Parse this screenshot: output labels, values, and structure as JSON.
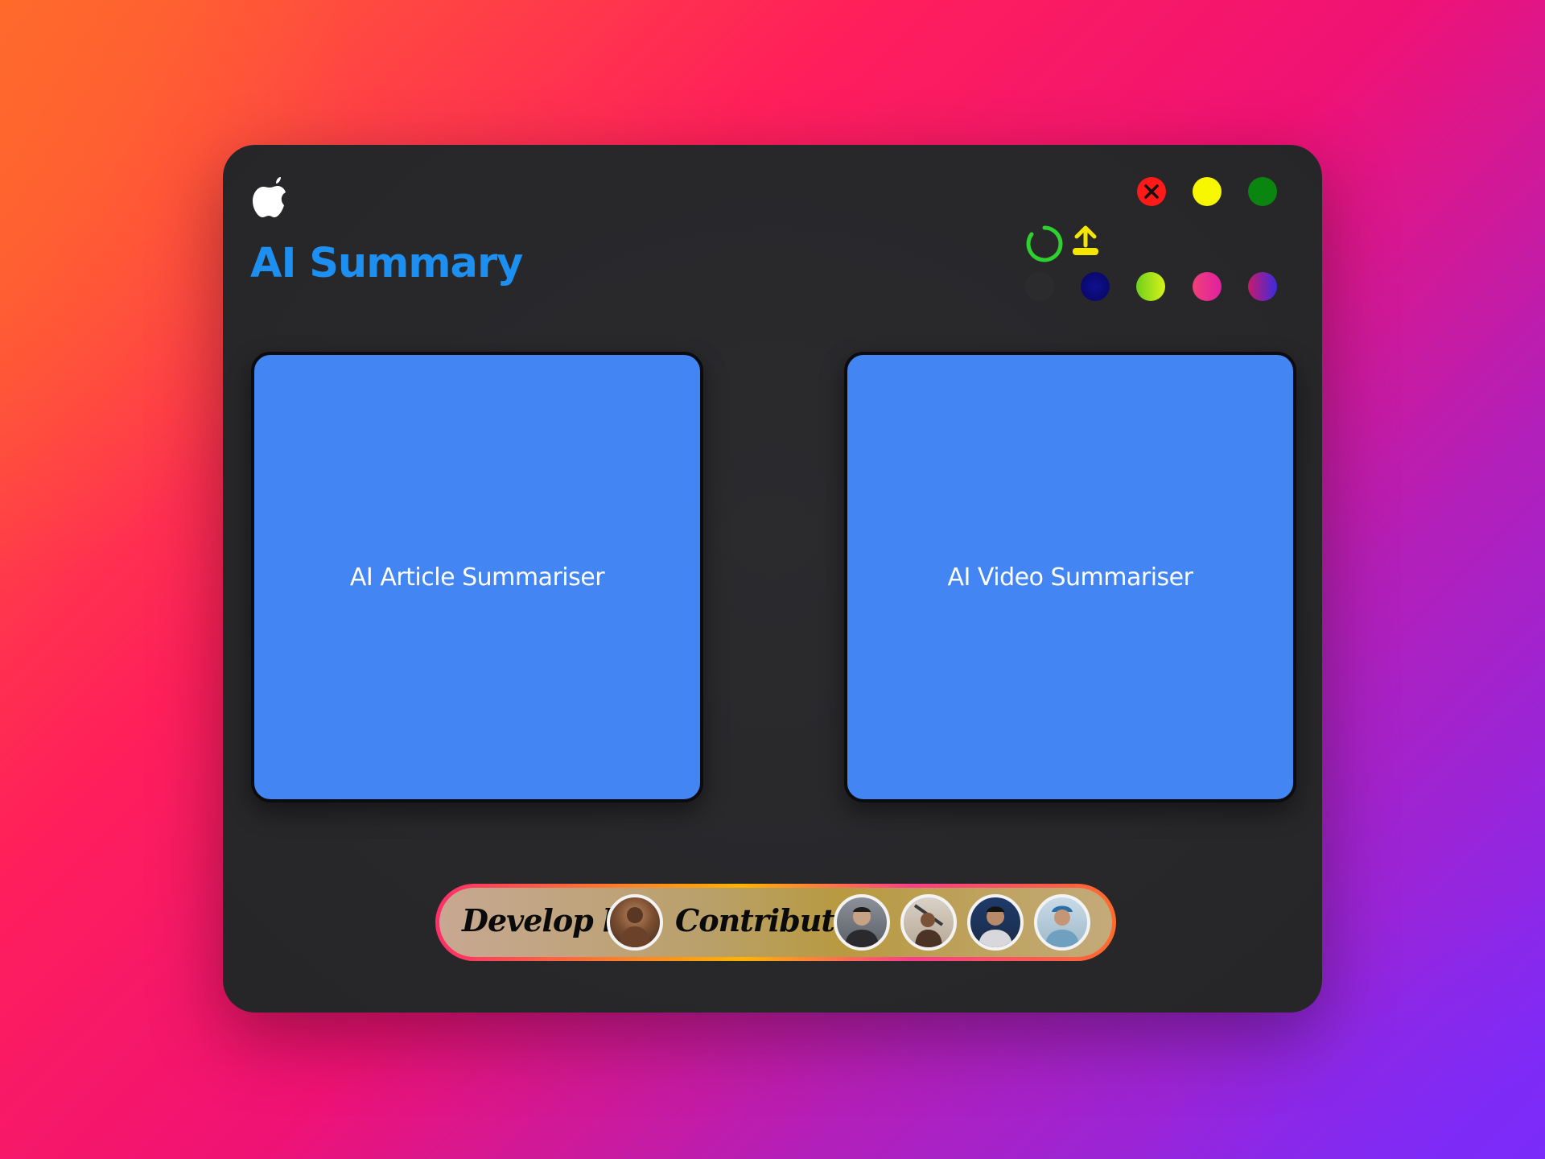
{
  "window": {
    "title": "AI Summary",
    "logo_icon": "apple-logo-icon"
  },
  "traffic_lights": [
    {
      "name": "close",
      "color": "#ff1a1a",
      "icon": "close-icon"
    },
    {
      "name": "minimize",
      "color": "#f7f700"
    },
    {
      "name": "maximize",
      "color": "#0a850f"
    }
  ],
  "toolbar": {
    "icons": [
      "refresh-icon",
      "upload-icon"
    ],
    "refresh_color": "#2fd12f",
    "upload_color": "#f5e600"
  },
  "theme_swatches": [
    {
      "name": "dark",
      "color": "#2b2b2d"
    },
    {
      "name": "navy",
      "color": "#0a0a8c"
    },
    {
      "name": "lime",
      "color": "#b8e61a"
    },
    {
      "name": "pink",
      "color": "#f0407a"
    },
    {
      "name": "purple",
      "color": "#6b2ad8"
    }
  ],
  "cards": [
    {
      "label": "AI Article Summariser"
    },
    {
      "label": "AI Video Summariser"
    }
  ],
  "credits": {
    "develop_label": "Develop by",
    "contributor_label": "Contributor",
    "developer_avatar_count": 1,
    "contributor_avatar_count": 4
  },
  "colors": {
    "title": "#1c8ff0",
    "card": "#4385f3",
    "window": "#28282b"
  }
}
